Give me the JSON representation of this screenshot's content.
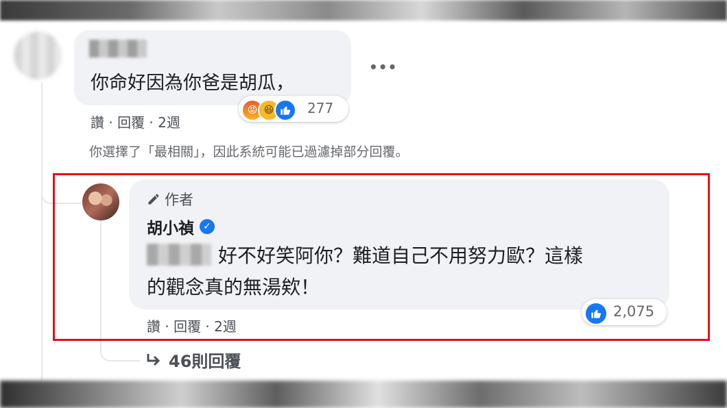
{
  "comment1": {
    "text": "你命好因為你爸是胡瓜，",
    "more": "•••",
    "reaction_count": "277",
    "reaction_icons": [
      "angry-icon",
      "haha-icon",
      "like-icon"
    ],
    "actions": "讚 · 回覆 · 2週"
  },
  "filter_note": "你選擇了「最相關」，因此系統可能已過濾掉部分回覆。",
  "reply": {
    "author_badge": "作者",
    "name": "胡小禎",
    "text_line1": "好不好笑阿你？難道自己不用努力歐？這樣",
    "text_line2": "的觀念真的無湯欸！",
    "like_count": "2,075",
    "actions": "讚 · 回覆 · 2週"
  },
  "more_replies": "46則回覆",
  "colors": {
    "highlight": "#e0101a",
    "like_blue": "#1877f2",
    "bubble": "#f0f2f5"
  }
}
